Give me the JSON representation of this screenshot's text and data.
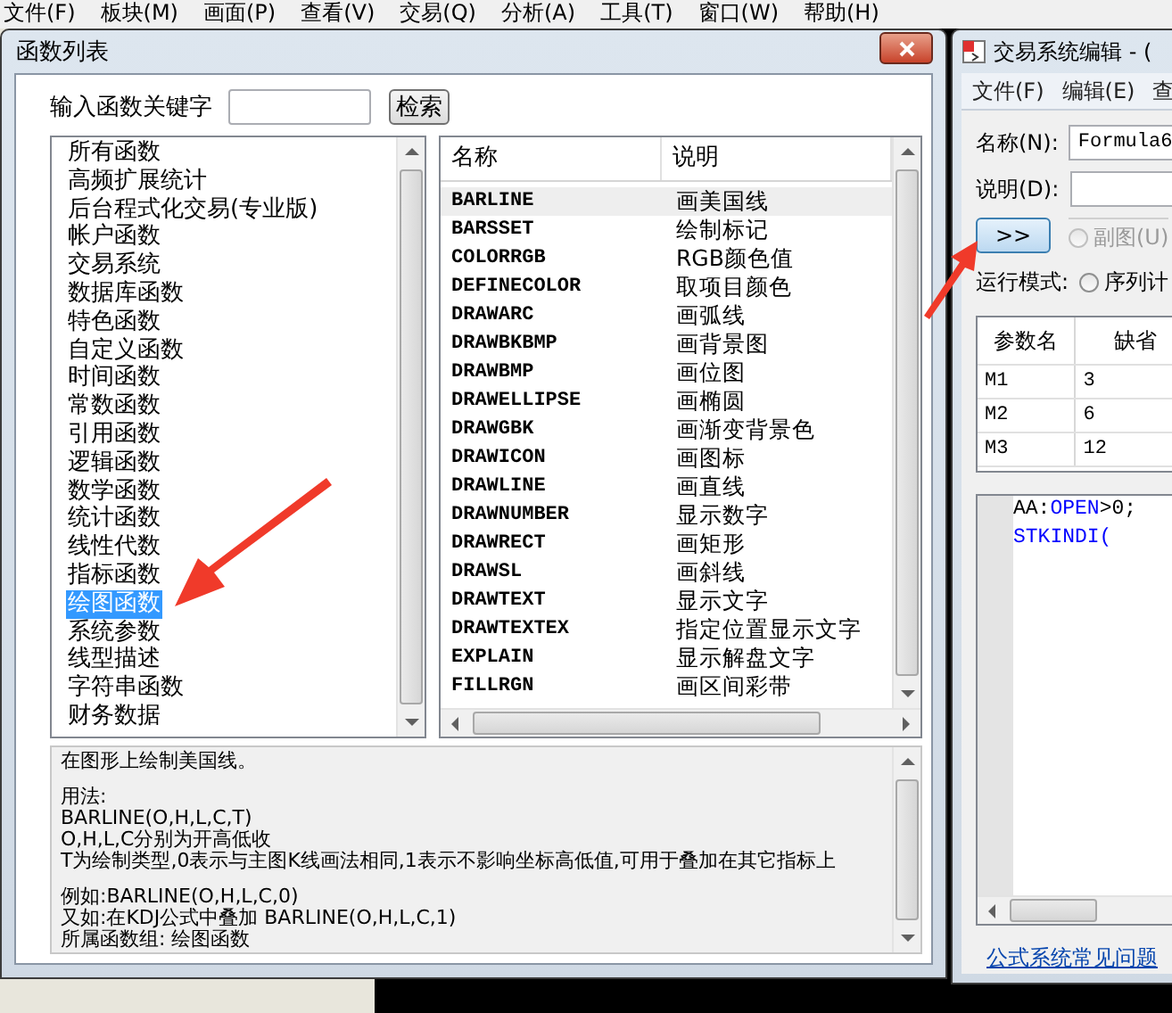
{
  "background_menu": [
    "文件(F)",
    "板块(M)",
    "画面(P)",
    "查看(V)",
    "交易(Q)",
    "分析(A)",
    "工具(T)",
    "窗口(W)",
    "帮助(H)"
  ],
  "function_dialog": {
    "title": "函数列表",
    "search_label": "输入函数关键字",
    "search_button": "检索",
    "categories": [
      {
        "label": "所有函数",
        "selected": false
      },
      {
        "label": "高频扩展统计",
        "selected": false
      },
      {
        "label": "后台程式化交易(专业版)",
        "selected": false
      },
      {
        "label": "帐户函数",
        "selected": false
      },
      {
        "label": "交易系统",
        "selected": false
      },
      {
        "label": "数据库函数",
        "selected": false
      },
      {
        "label": "特色函数",
        "selected": false
      },
      {
        "label": "自定义函数",
        "selected": false
      },
      {
        "label": "时间函数",
        "selected": false
      },
      {
        "label": "常数函数",
        "selected": false
      },
      {
        "label": "引用函数",
        "selected": false
      },
      {
        "label": "逻辑函数",
        "selected": false
      },
      {
        "label": "数学函数",
        "selected": false
      },
      {
        "label": "统计函数",
        "selected": false
      },
      {
        "label": "线性代数",
        "selected": false
      },
      {
        "label": "指标函数",
        "selected": false
      },
      {
        "label": "绘图函数",
        "selected": true
      },
      {
        "label": "系统参数",
        "selected": false
      },
      {
        "label": "线型描述",
        "selected": false
      },
      {
        "label": "字符串函数",
        "selected": false
      },
      {
        "label": "财务数据",
        "selected": false
      }
    ],
    "columns": [
      "名称",
      "说明"
    ],
    "functions": [
      {
        "name": "BARLINE",
        "description": "画美国线",
        "selected": true
      },
      {
        "name": "BARSSET",
        "description": "绘制标记",
        "selected": false
      },
      {
        "name": "COLORRGB",
        "description": "RGB颜色值",
        "selected": false
      },
      {
        "name": "DEFINECOLOR",
        "description": "取项目颜色",
        "selected": false
      },
      {
        "name": "DRAWARC",
        "description": "画弧线",
        "selected": false
      },
      {
        "name": "DRAWBKBMP",
        "description": "画背景图",
        "selected": false
      },
      {
        "name": "DRAWBMP",
        "description": "画位图",
        "selected": false
      },
      {
        "name": "DRAWELLIPSE",
        "description": "画椭圆",
        "selected": false
      },
      {
        "name": "DRAWGBK",
        "description": "画渐变背景色",
        "selected": false
      },
      {
        "name": "DRAWICON",
        "description": "画图标",
        "selected": false
      },
      {
        "name": "DRAWLINE",
        "description": "画直线",
        "selected": false
      },
      {
        "name": "DRAWNUMBER",
        "description": "显示数字",
        "selected": false
      },
      {
        "name": "DRAWRECT",
        "description": "画矩形",
        "selected": false
      },
      {
        "name": "DRAWSL",
        "description": "画斜线",
        "selected": false
      },
      {
        "name": "DRAWTEXT",
        "description": "显示文字",
        "selected": false
      },
      {
        "name": "DRAWTEXTEX",
        "description": "指定位置显示文字",
        "selected": false
      },
      {
        "name": "EXPLAIN",
        "description": "显示解盘文字",
        "selected": false
      },
      {
        "name": "FILLRGN",
        "description": "画区间彩带",
        "selected": false
      }
    ],
    "help_paragraphs": [
      [
        "在图形上绘制美国线。"
      ],
      [
        "用法:",
        "BARLINE(O,H,L,C,T)",
        "O,H,L,C分别为开高低收",
        "T为绘制类型,0表示与主图K线画法相同,1表示不影响坐标高低值,可用于叠加在其它指标上"
      ],
      [
        "例如:BARLINE(O,H,L,C,0)",
        "又如:在KDJ公式中叠加 BARLINE(O,H,L,C,1)",
        "所属函数组: 绘图函数"
      ]
    ]
  },
  "editor_window": {
    "title": "交易系统编辑 - (",
    "menu": [
      "文件(F)",
      "编辑(E)",
      "查"
    ],
    "name_label": "名称(N):",
    "name_value": "Formula6",
    "desc_label": "说明(D):",
    "expand_button": ">>",
    "chart_radio": {
      "label": "副图(U)",
      "selected": false,
      "disabled": true
    },
    "run_mode_label": "运行模式:",
    "run_mode_radio": {
      "label": "序列计",
      "selected": false,
      "disabled": false
    },
    "param_columns": [
      "参数名",
      "缺省"
    ],
    "param_rows": [
      [
        "M1",
        "3"
      ],
      [
        "M2",
        "6"
      ],
      [
        "M3",
        "12"
      ]
    ],
    "code_lines": [
      [
        {
          "text": "AA:",
          "kind": "plain"
        },
        {
          "text": "OPEN",
          "kind": "keyword"
        },
        {
          "text": ">0;",
          "kind": "plain"
        }
      ],
      [
        {
          "text": "STKINDI(",
          "kind": "keyword"
        }
      ]
    ],
    "help_link": "公式系统常见问题"
  }
}
